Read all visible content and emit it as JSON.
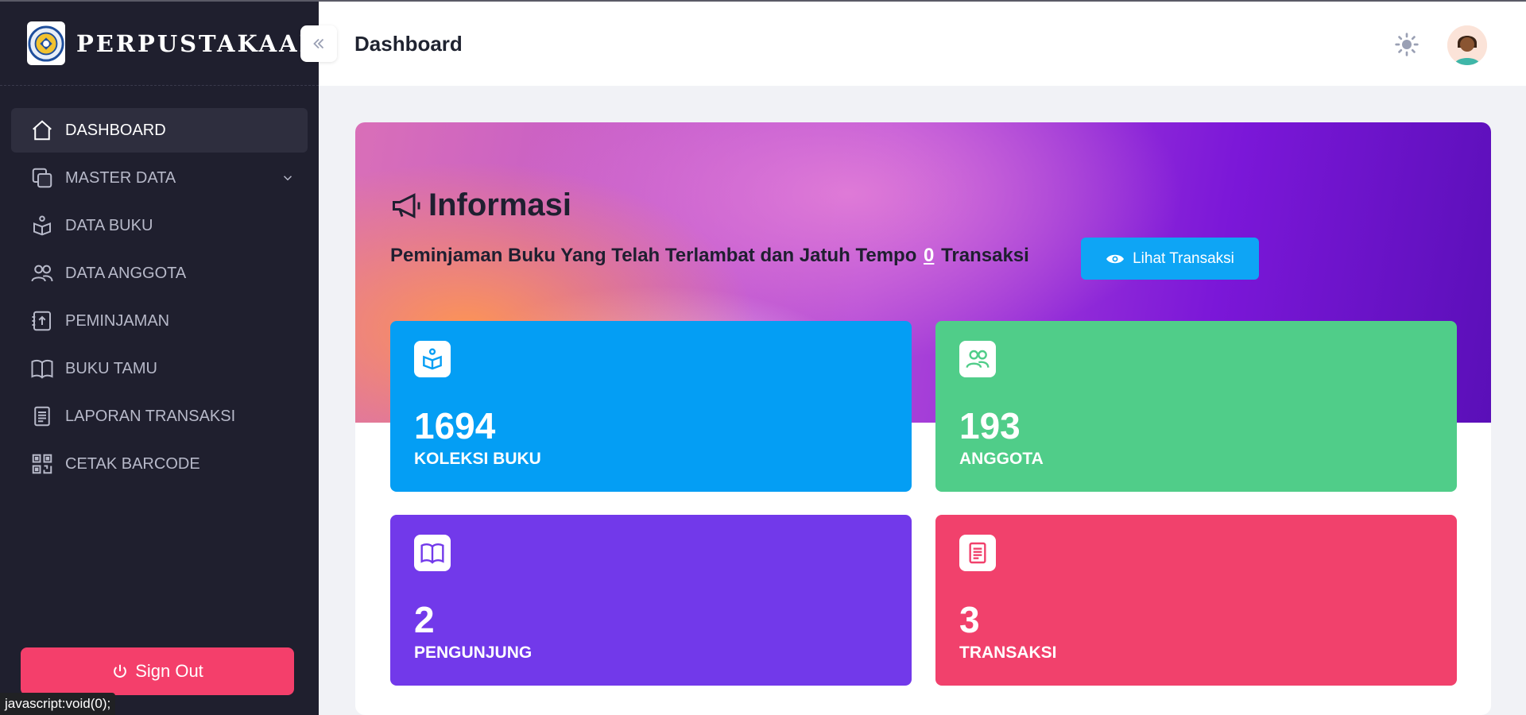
{
  "sidebar": {
    "brand": "PERPUSTAKAAN",
    "items": [
      {
        "label": "DASHBOARD",
        "icon": "home-icon",
        "active": true
      },
      {
        "label": "MASTER DATA",
        "icon": "layers-icon",
        "has_submenu": true
      },
      {
        "label": "DATA BUKU",
        "icon": "book-reader-icon"
      },
      {
        "label": "DATA ANGGOTA",
        "icon": "users-icon"
      },
      {
        "label": "PEMINJAMAN",
        "icon": "upload-doc-icon"
      },
      {
        "label": "BUKU TAMU",
        "icon": "open-book-icon"
      },
      {
        "label": "LAPORAN TRANSAKSI",
        "icon": "document-icon"
      },
      {
        "label": "CETAK BARCODE",
        "icon": "qrcode-icon"
      }
    ],
    "signout_label": "Sign Out"
  },
  "status_url": "javascript:void(0);",
  "header": {
    "title": "Dashboard"
  },
  "hero": {
    "title": "Informasi",
    "text_before": "Peminjaman Buku Yang Telah Terlambat dan Jatuh Tempo",
    "count": "0",
    "text_after": "Transaksi",
    "button_label": "Lihat Transaksi"
  },
  "stats": [
    {
      "value": "1694",
      "label": "KOLEKSI BUKU",
      "color": "#049ef4",
      "icon": "book-reader-icon"
    },
    {
      "value": "193",
      "label": "ANGGOTA",
      "color": "#50cd89",
      "icon": "users-icon"
    },
    {
      "value": "2",
      "label": "PENGUNJUNG",
      "color": "#7239ea",
      "icon": "open-book-icon"
    },
    {
      "value": "3",
      "label": "TRANSAKSI",
      "color": "#f1416c",
      "icon": "document-icon"
    }
  ],
  "colors": {
    "sidebar_bg": "#1f1f2e",
    "signout": "#f43f6b",
    "button_primary": "#0ea5f5"
  }
}
